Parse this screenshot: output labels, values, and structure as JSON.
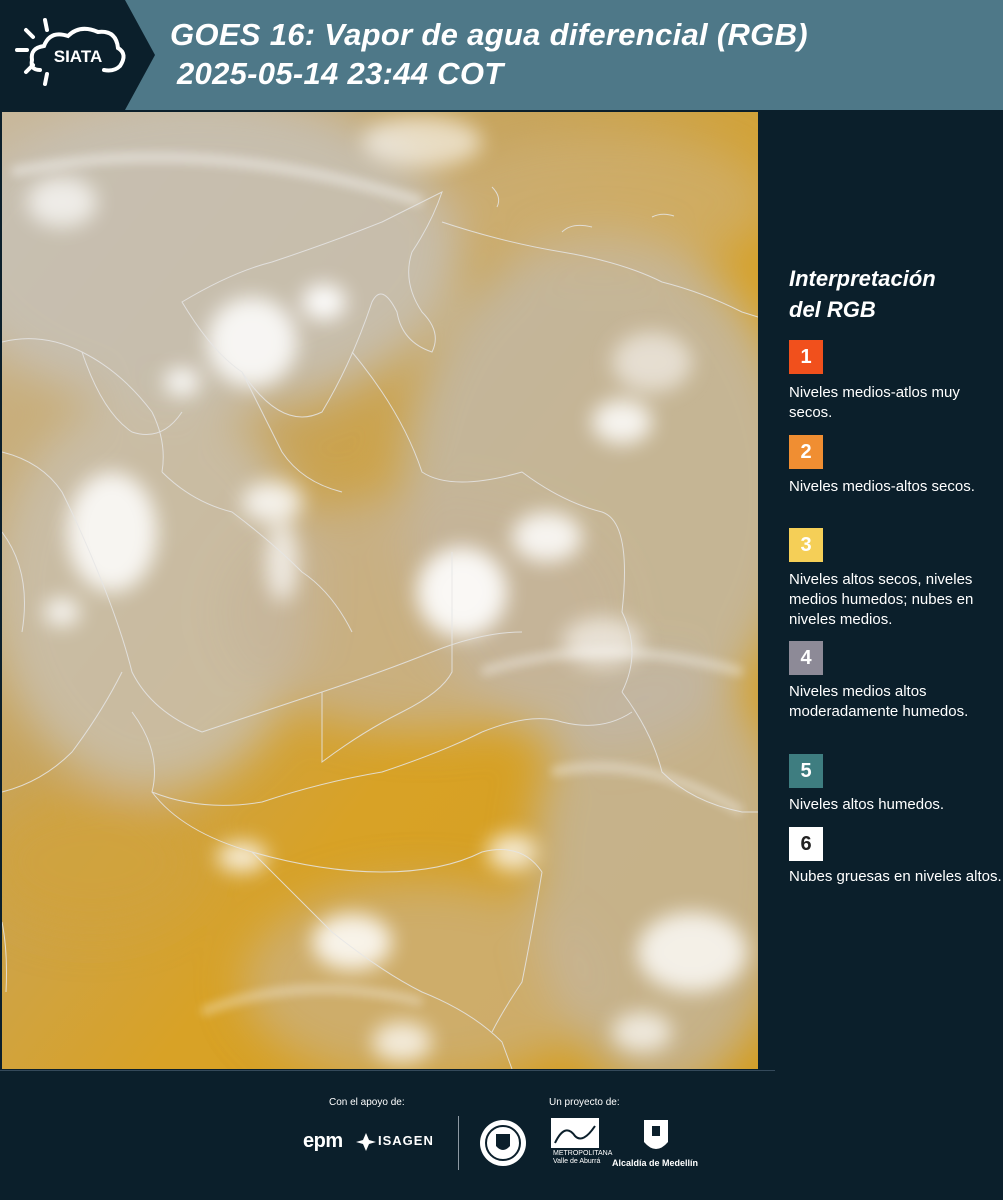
{
  "header": {
    "logo_text": "SIATA",
    "title_line1": "GOES 16: Vapor de agua diferencial (RGB)",
    "title_line2": "2025-05-14 23:44 COT"
  },
  "legend": {
    "title_line1": "Interpretación",
    "title_line2": "del RGB",
    "items": [
      {
        "number": "1",
        "color": "#f1501c",
        "text_color": "#ffffff",
        "label": "Niveles medios-atlos muy secos."
      },
      {
        "number": "2",
        "color": "#f08e32",
        "text_color": "#ffffff",
        "label": "Niveles medios-altos secos."
      },
      {
        "number": "3",
        "color": "#f5cf57",
        "text_color": "#ffffff",
        "label": "Niveles altos secos, niveles medios humedos; nubes en niveles medios."
      },
      {
        "number": "4",
        "color": "#8d8a97",
        "text_color": "#ffffff",
        "label": "Niveles medios altos moderadamente humedos."
      },
      {
        "number": "5",
        "color": "#3e7d80",
        "text_color": "#ffffff",
        "label": "Niveles altos humedos."
      },
      {
        "number": "6",
        "color": "#ffffff",
        "text_color": "#222222",
        "label": "Nubes gruesas en niveles altos."
      }
    ]
  },
  "footer": {
    "support_label": "Con el apoyo de:",
    "project_label": "Un proyecto de:",
    "epm_text": "epm",
    "isagen_text": "ISAGEN",
    "area_line1": "METROPOLITANA",
    "area_line2": "Valle de Aburrá",
    "alcaldia_text": "Alcaldía de Medellín"
  },
  "colors": {
    "header_bg": "#4e7888",
    "panel_bg": "#0b1f2b",
    "map_dry": "#d9a21a"
  }
}
